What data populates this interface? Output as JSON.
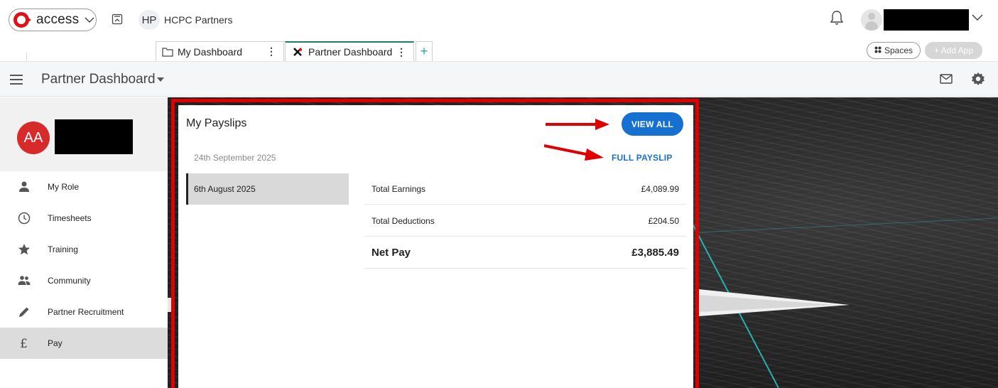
{
  "topbar": {
    "brand": "access",
    "org_badge": "HP",
    "org_name": "HCPC Partners"
  },
  "tabs": [
    {
      "label": "My Dashboard"
    },
    {
      "label": "Partner Dashboard"
    }
  ],
  "tab_menu_glyph": "⋮",
  "tab_add_glyph": "+",
  "spaces_label": "Spaces",
  "add_app_label": "+ Add App",
  "appbar": {
    "title": "Partner Dashboard"
  },
  "profile": {
    "initials": "AA"
  },
  "sidebar": {
    "items": [
      {
        "label": "My Role",
        "icon": "person-icon"
      },
      {
        "label": "Timesheets",
        "icon": "clock-icon"
      },
      {
        "label": "Training",
        "icon": "star-icon"
      },
      {
        "label": "Community",
        "icon": "people-icon"
      },
      {
        "label": "Partner Recruitment",
        "icon": "pencil-icon"
      },
      {
        "label": "Pay",
        "icon": "pound-icon",
        "active": true
      }
    ]
  },
  "payslips": {
    "title": "My Payslips",
    "view_all_label": "VIEW ALL",
    "full_payslip_label": "FULL PAYSLIP",
    "dates": [
      "24th September 2025",
      "6th August 2025"
    ],
    "selected_date_index": 1,
    "rows": [
      {
        "label": "Total Earnings",
        "value": "£4,089.99"
      },
      {
        "label": "Total Deductions",
        "value": "£204.50"
      },
      {
        "label": "Net Pay",
        "value": "£3,885.49"
      }
    ]
  },
  "colors": {
    "brand_red": "#e0101a",
    "primary_blue": "#1570d0",
    "teal": "#1f7a72",
    "highlight_red": "#e00000",
    "avatar_red": "#d72a2a"
  }
}
